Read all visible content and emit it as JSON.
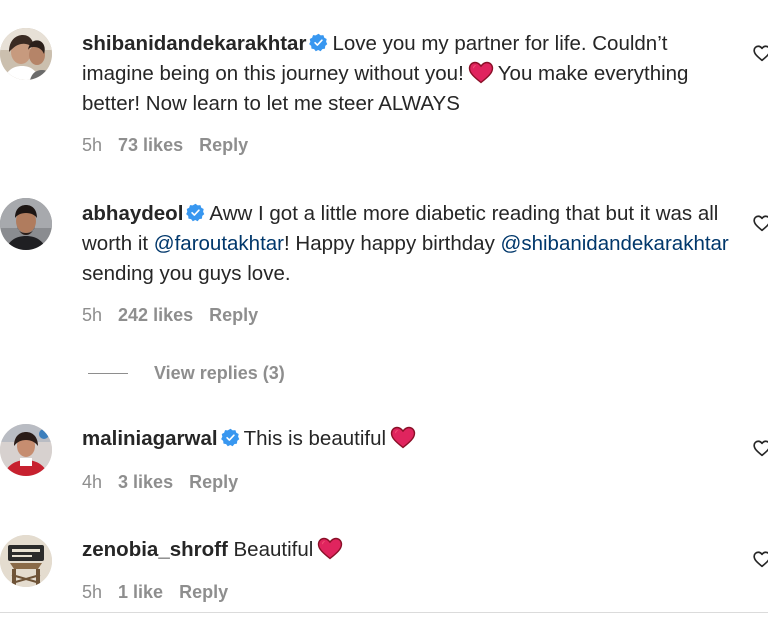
{
  "comments": [
    {
      "username": "shibanidandekarakhtar",
      "verified": true,
      "text_1": "Love you my partner for life. Couldn’t imagine being on this journey without you!",
      "text_2": "You make everything better! Now learn to let me steer ALWAYS",
      "time": "5h",
      "likes": "73 likes",
      "reply": "Reply"
    },
    {
      "username": "abhaydeol",
      "verified": true,
      "text_1": "Aww I got a little more diabetic reading that but it was all worth it",
      "mention_1": "@faroutakhtar",
      "text_2": "! Happy happy birthday",
      "mention_2": "@shibanidandekarakhtar",
      "text_3": "sending you guys love.",
      "time": "5h",
      "likes": "242 likes",
      "reply": "Reply",
      "view_replies": "View replies (3)"
    },
    {
      "username": "maliniagarwal",
      "verified": true,
      "text_1": "This is beautiful",
      "time": "4h",
      "likes": "3 likes",
      "reply": "Reply"
    },
    {
      "username": "zenobia_shroff",
      "verified": false,
      "text_1": "Beautiful",
      "time": "5h",
      "likes": "1 like",
      "reply": "Reply"
    }
  ],
  "colors": {
    "verified": "#3897f0",
    "heart": "#ed4956",
    "mention": "#00376b",
    "meta": "#8e8e8e"
  },
  "icons": {
    "verified": "verified-badge-icon",
    "heart": "red-heart-emoji-icon",
    "like": "heart-outline-icon"
  }
}
